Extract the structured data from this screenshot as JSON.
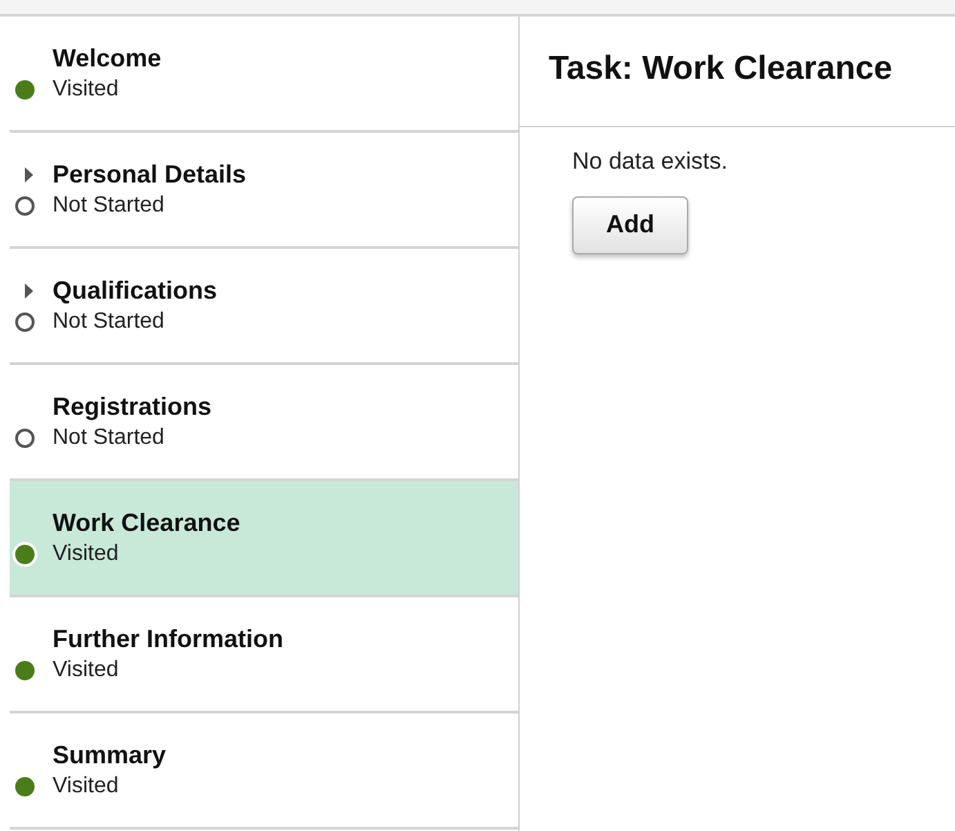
{
  "sidebar": {
    "items": [
      {
        "title": "Welcome",
        "status": "Visited",
        "visited": true,
        "expandable": false,
        "selected": false
      },
      {
        "title": "Personal Details",
        "status": "Not Started",
        "visited": false,
        "expandable": true,
        "selected": false
      },
      {
        "title": "Qualifications",
        "status": "Not Started",
        "visited": false,
        "expandable": true,
        "selected": false
      },
      {
        "title": "Registrations",
        "status": "Not Started",
        "visited": false,
        "expandable": false,
        "selected": false
      },
      {
        "title": "Work Clearance",
        "status": "Visited",
        "visited": true,
        "expandable": false,
        "selected": true
      },
      {
        "title": "Further Information",
        "status": "Visited",
        "visited": true,
        "expandable": false,
        "selected": false
      },
      {
        "title": "Summary",
        "status": "Visited",
        "visited": true,
        "expandable": false,
        "selected": false
      }
    ]
  },
  "content": {
    "title": "Task: Work Clearance",
    "message": "No data exists.",
    "button": "Add"
  }
}
